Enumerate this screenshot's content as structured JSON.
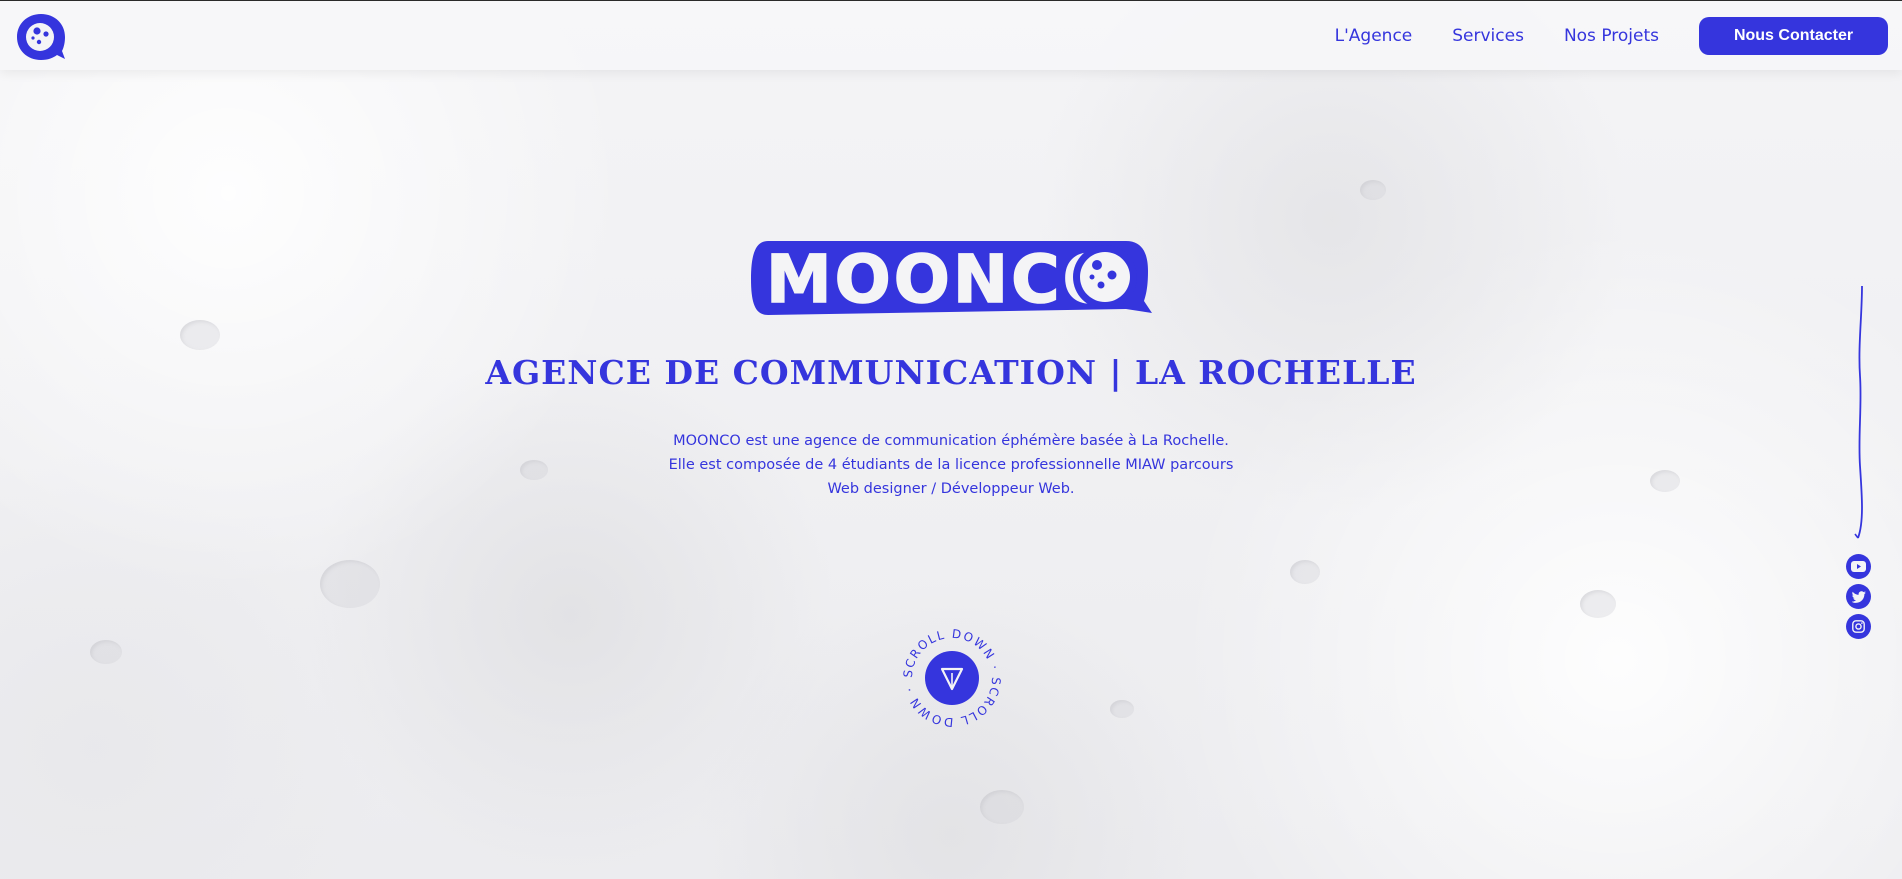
{
  "brand": {
    "name": "MOONCO",
    "color": "#3535dd"
  },
  "nav": {
    "items": [
      {
        "label": "L'Agence"
      },
      {
        "label": "Services"
      },
      {
        "label": "Nos Projets"
      }
    ],
    "cta_label": "Nous Contacter"
  },
  "hero": {
    "logo_text": "MOONCO",
    "tagline": "AGENCE DE COMMUNICATION | LA ROCHELLE",
    "description_line1": "MOONCO est une agence de communication éphémère basée à La Rochelle.",
    "description_line2": "Elle est composée de 4 étudiants de la licence professionnelle MIAW parcours Web designer / Développeur Web."
  },
  "scroll": {
    "label": "SCROLL DOWN · SCROLL DOWN ·",
    "icon": "arrow-down-icon"
  },
  "social": {
    "icons": [
      "youtube-icon",
      "twitter-icon",
      "instagram-icon"
    ]
  }
}
